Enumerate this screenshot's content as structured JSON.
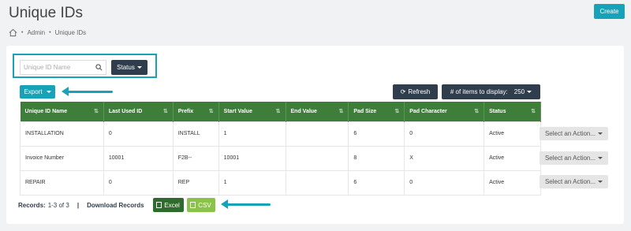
{
  "header": {
    "title": "Unique IDs",
    "create_label": "Create"
  },
  "breadcrumb": {
    "items": [
      "Admin",
      "Unique IDs"
    ]
  },
  "search": {
    "placeholder": "Unique ID Name",
    "status_label": "Status"
  },
  "toolbar": {
    "export_label": "Export",
    "refresh_label": "Refresh",
    "items_label": "# of items to display:",
    "items_value": "250"
  },
  "table": {
    "columns": [
      "Unique ID Name",
      "Last Used ID",
      "Prefix",
      "Start Value",
      "End Value",
      "Pad Size",
      "Pad Character",
      "Status"
    ],
    "rows": [
      [
        "INSTALLATION",
        "0",
        "INSTALL",
        "1",
        "",
        "6",
        "0",
        "Active"
      ],
      [
        "Invoice Number",
        "10001",
        "F2B--",
        "10001",
        "",
        "8",
        "X",
        "Active"
      ],
      [
        "REPAIR",
        "0",
        "REP",
        "1",
        "",
        "6",
        "0",
        "Active"
      ]
    ],
    "action_label": "Select an Action..."
  },
  "footer": {
    "records_label": "Records:",
    "records_value": "1-3 of 3",
    "download_label": "Download Records",
    "excel_label": "Excel",
    "csv_label": "CSV"
  },
  "colors": {
    "accent": "#17a2b8",
    "dark": "#2f3d4c",
    "table_header": "#3e7d3a",
    "excel": "#2f6b2d",
    "csv": "#8bc34a"
  }
}
